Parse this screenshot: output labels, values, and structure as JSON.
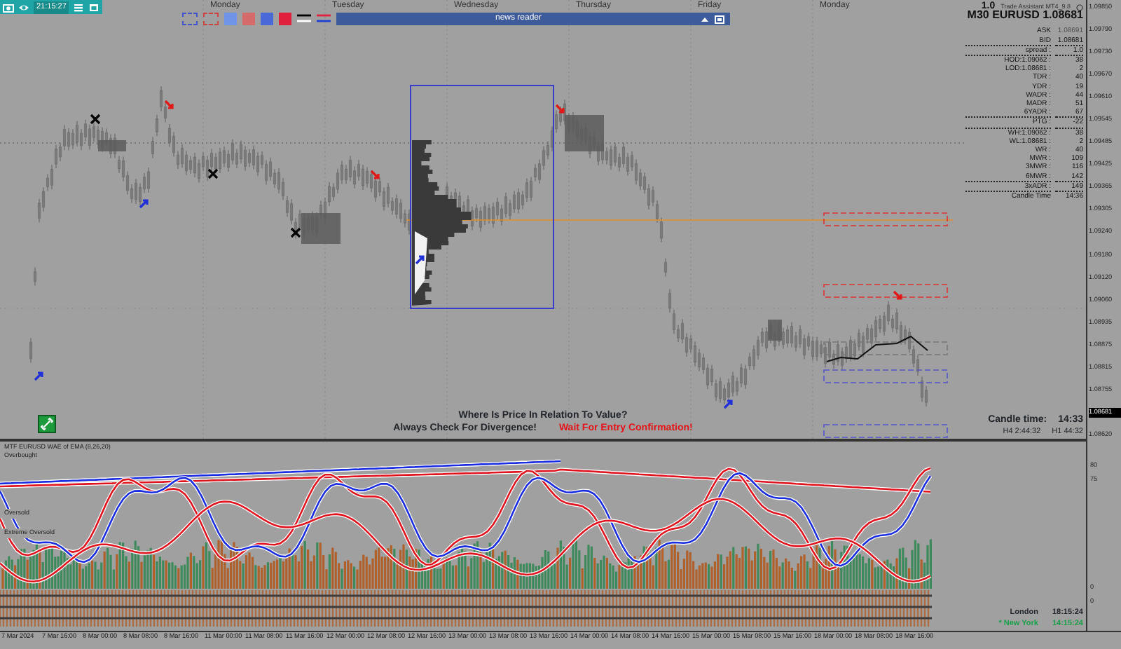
{
  "toolbar": {
    "time": "21:15:27",
    "swatches": [
      {
        "color": "#6f94e8"
      },
      {
        "color": "#d46a6a"
      },
      {
        "color": "#4a68d8"
      },
      {
        "color": "#e0203c"
      }
    ]
  },
  "news_reader": {
    "title": "news reader"
  },
  "day_labels": [
    "Monday",
    "Tuesday",
    "Wednesday",
    "Thursday",
    "Friday",
    "Monday"
  ],
  "info_panel": {
    "version": "1.0",
    "app": "Trade Assistant MT4_9.8",
    "symbol": "M30 EURUSD 1.08681",
    "rows": [
      {
        "label": "ASK",
        "value": "1.08691",
        "dim": true,
        "divider": false
      },
      {
        "label": "BID",
        "value": "1.08681",
        "dim": false,
        "divider": false
      },
      {
        "label": "spread :",
        "value": "1.0",
        "dim": false,
        "divider": true
      },
      {
        "label": "HOD:1.09062 :",
        "value": "38",
        "dim": false,
        "divider": true
      },
      {
        "label": "LOD:1.08681 :",
        "value": "2",
        "dim": false,
        "divider": false
      },
      {
        "label": "TDR :",
        "value": "40",
        "dim": false,
        "divider": false
      },
      {
        "label": "YDR :",
        "value": "19",
        "dim": false,
        "divider": false
      },
      {
        "label": "WADR :",
        "value": "44",
        "dim": false,
        "divider": false
      },
      {
        "label": "MADR :",
        "value": "51",
        "dim": false,
        "divider": false
      },
      {
        "label": "6YADR :",
        "value": "67",
        "dim": false,
        "divider": false
      },
      {
        "label": "PTG :",
        "value": "-22",
        "dim": false,
        "divider": true
      },
      {
        "label": "WH:1.09062 :",
        "value": "38",
        "dim": false,
        "divider": true
      },
      {
        "label": "WL:1.08681 :",
        "value": "2",
        "dim": false,
        "divider": false
      },
      {
        "label": "WR :",
        "value": "40",
        "dim": false,
        "divider": false
      },
      {
        "label": "MWR :",
        "value": "109",
        "dim": false,
        "divider": false
      },
      {
        "label": "3MWR :",
        "value": "116",
        "dim": false,
        "divider": false
      },
      {
        "label": "6MWR :",
        "value": "142",
        "dim": false,
        "divider": false
      },
      {
        "label": "3xADR :",
        "value": "149",
        "dim": false,
        "divider": true
      },
      {
        "label": "Candle Time",
        "value": "14:36",
        "dim": false,
        "divider": true
      }
    ]
  },
  "price_axis": [
    {
      "text": "1.09850",
      "highlighted": false
    },
    {
      "text": "1.09790",
      "highlighted": false
    },
    {
      "text": "1.09730",
      "highlighted": false
    },
    {
      "text": "1.09670",
      "highlighted": false
    },
    {
      "text": "1.09610",
      "highlighted": false
    },
    {
      "text": "1.09545",
      "highlighted": false
    },
    {
      "text": "1.09485",
      "highlighted": false
    },
    {
      "text": "1.09425",
      "highlighted": false
    },
    {
      "text": "1.09365",
      "highlighted": false
    },
    {
      "text": "1.09305",
      "highlighted": false
    },
    {
      "text": "1.09240",
      "highlighted": false
    },
    {
      "text": "1.09180",
      "highlighted": false
    },
    {
      "text": "1.09120",
      "highlighted": false
    },
    {
      "text": "1.09060",
      "highlighted": false
    },
    {
      "text": "1.08935",
      "highlighted": false
    },
    {
      "text": "1.08875",
      "highlighted": false
    },
    {
      "text": "1.08815",
      "highlighted": false
    },
    {
      "text": "1.08755",
      "highlighted": false
    },
    {
      "text": "1.08681",
      "highlighted": true
    },
    {
      "text": "1.08620",
      "highlighted": false
    }
  ],
  "messages": {
    "question": "Where Is Price In Relation To Value?",
    "reminder": "Always Check For Divergence!",
    "warning": "Wait For Entry Confirmation!"
  },
  "candle_timer": {
    "label": "Candle time:",
    "time": "14:33",
    "h4": "H4 2:44:32",
    "h1": "H1 44:32"
  },
  "indicator": {
    "title": "MTF EURUSD WAE of EMA (8,26,20)",
    "levels": [
      "Overbought",
      "Oversold",
      "Extreme Oversold"
    ],
    "axis": [
      "80",
      "75",
      "0",
      "0"
    ]
  },
  "clocks": [
    {
      "city": "London",
      "time": "18:15:24",
      "local": false
    },
    {
      "city": "* New York",
      "time": "14:15:24",
      "local": true
    }
  ],
  "time_axis": [
    "7 Mar 2024",
    "7 Mar 16:00",
    "8 Mar 00:00",
    "8 Mar 08:00",
    "8 Mar 16:00",
    "11 Mar 00:00",
    "11 Mar 08:00",
    "11 Mar 16:00",
    "12 Mar 00:00",
    "12 Mar 08:00",
    "12 Mar 16:00",
    "13 Mar 00:00",
    "13 Mar 08:00",
    "13 Mar 16:00",
    "14 Mar 00:00",
    "14 Mar 08:00",
    "14 Mar 16:00",
    "15 Mar 00:00",
    "15 Mar 08:00",
    "15 Mar 16:00",
    "18 Mar 00:00",
    "18 Mar 08:00",
    "18 Mar 16:00"
  ]
}
